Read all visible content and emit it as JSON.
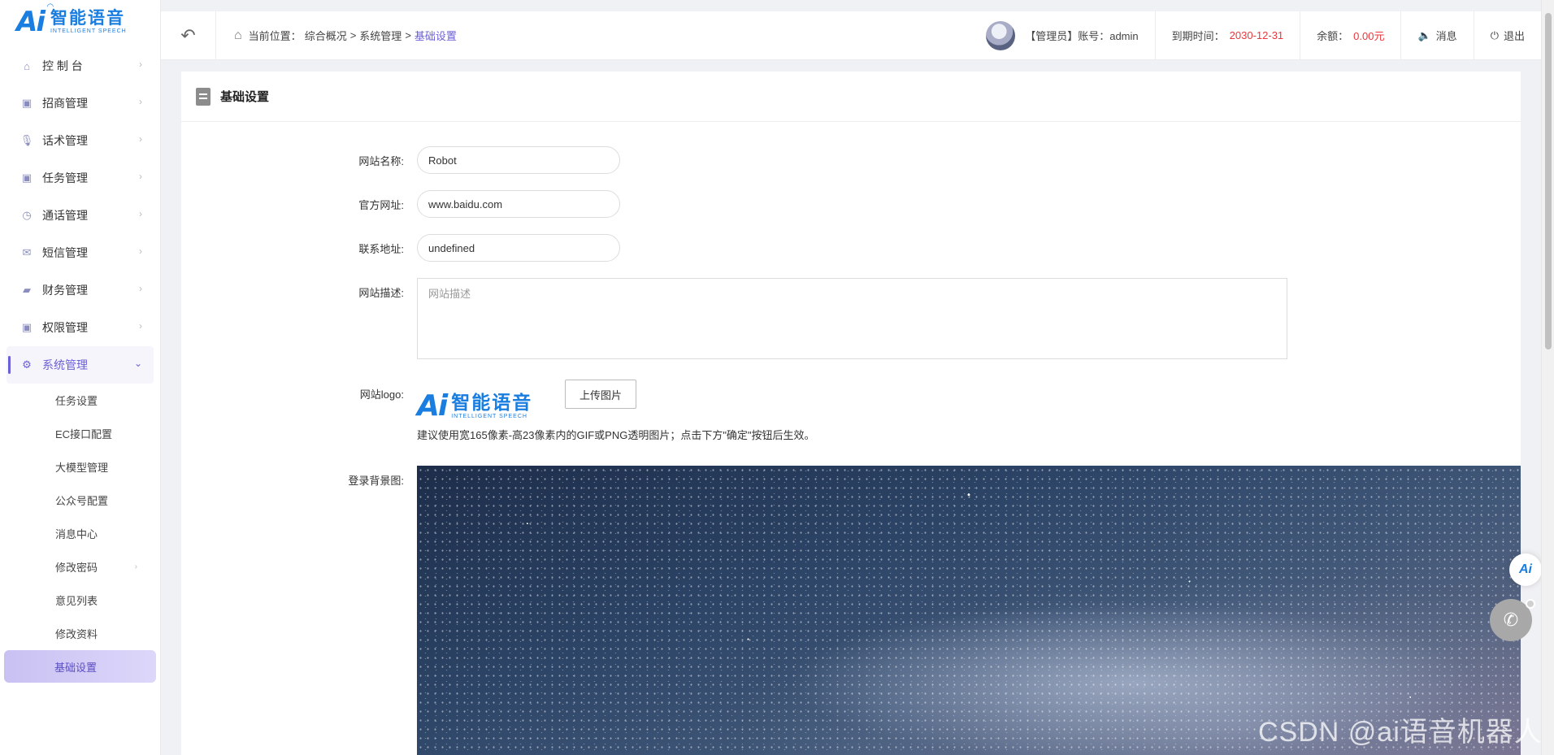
{
  "brand": {
    "mark": "Ai",
    "name_cn": "智能语音",
    "name_en": "INTELLIGENT SPEECH"
  },
  "sidebar": {
    "items": [
      {
        "label": "控 制 台",
        "icon": "home-icon"
      },
      {
        "label": "招商管理",
        "icon": "clipboard-icon"
      },
      {
        "label": "话术管理",
        "icon": "mic-icon"
      },
      {
        "label": "任务管理",
        "icon": "clipboard-icon"
      },
      {
        "label": "通话管理",
        "icon": "clock-icon"
      },
      {
        "label": "短信管理",
        "icon": "mail-icon"
      },
      {
        "label": "财务管理",
        "icon": "wallet-icon"
      },
      {
        "label": "权限管理",
        "icon": "clipboard-icon"
      },
      {
        "label": "系统管理",
        "icon": "gear-icon"
      }
    ],
    "submenu": [
      "任务设置",
      "EC接口配置",
      "大模型管理",
      "公众号配置",
      "消息中心",
      "修改密码",
      "意见列表",
      "修改资料",
      "基础设置"
    ]
  },
  "header": {
    "crumb_prefix": "当前位置：",
    "crumb1": "综合概况",
    "sep": ">",
    "crumb2": "系统管理",
    "crumb3": "基础设置",
    "account": "【管理员】账号：admin",
    "expire_label": "到期时间：",
    "expire_value": "2030-12-31",
    "balance_label": "余额：",
    "balance_value": "0.00元",
    "messages": "消息",
    "logout": "退出"
  },
  "card": {
    "title": "基础设置"
  },
  "form": {
    "site_name_label": "网站名称:",
    "site_name_value": "Robot",
    "site_url_label": "官方网址:",
    "site_url_value": "www.baidu.com",
    "address_label": "联系地址:",
    "address_value": "undefined",
    "desc_label": "网站描述:",
    "desc_placeholder": "网站描述",
    "logo_label": "网站logo:",
    "upload_label": "上传图片",
    "logo_hint": "建议使用宽165像素-高23像素内的GIF或PNG透明图片；点击下方\"确定\"按钮后生效。",
    "bg_label": "登录背景图:"
  },
  "watermark": "CSDN @ai语音机器人",
  "float": {
    "ai": "Ai"
  },
  "colors": {
    "accent": "#6b5fd6",
    "brand": "#1a7de0",
    "danger": "#e8383d"
  }
}
